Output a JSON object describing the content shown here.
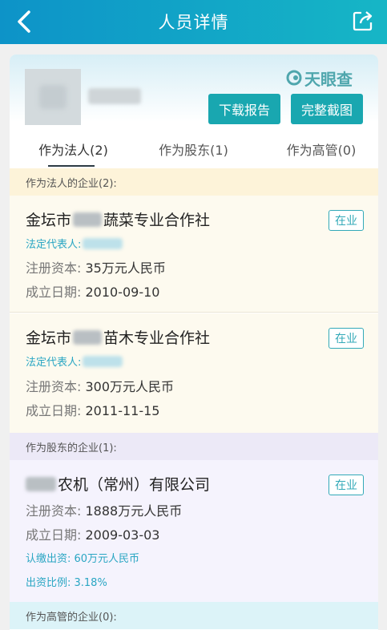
{
  "nav": {
    "title": "人员详情"
  },
  "header": {
    "brand": "天眼查",
    "buttons": {
      "report": "下载报告",
      "screenshot": "完整截图"
    }
  },
  "tabs": [
    {
      "label": "作为法人(2)",
      "active": true
    },
    {
      "label": "作为股东(1)",
      "active": false
    },
    {
      "label": "作为高管(0)",
      "active": false
    }
  ],
  "sections": {
    "legal": "作为法人的企业(2):",
    "shareholder": "作为股东的企业(1):",
    "executive": "作为高管的企业(0):"
  },
  "companies": [
    {
      "name_prefix": "金坛市",
      "name_suffix": "蔬菜专业合作社",
      "status": "在业",
      "rep_label": "法定代表人:",
      "capital_label": "注册资本:",
      "capital": "35万元人民币",
      "date_label": "成立日期:",
      "date": "2010-09-10"
    },
    {
      "name_prefix": "金坛市",
      "name_suffix": "苗木专业合作社",
      "status": "在业",
      "rep_label": "法定代表人:",
      "capital_label": "注册资本:",
      "capital": "300万元人民币",
      "date_label": "成立日期:",
      "date": "2011-11-15"
    },
    {
      "name_suffix": "农机（常州）有限公司",
      "status": "在业",
      "capital_label": "注册资本:",
      "capital": "1888万元人民币",
      "date_label": "成立日期:",
      "date": "2009-03-03",
      "subscribed": "认缴出资: 60万元人民币",
      "ratio": "出资比例: 3.18%"
    }
  ],
  "colors": {
    "accent": "#19a7b0",
    "nav_start": "#0d93c8",
    "nav_end": "#16b6c6"
  },
  "icons": {
    "back": "chevron-left-icon",
    "share": "share-icon",
    "brand": "tianyancha-logo-icon"
  }
}
